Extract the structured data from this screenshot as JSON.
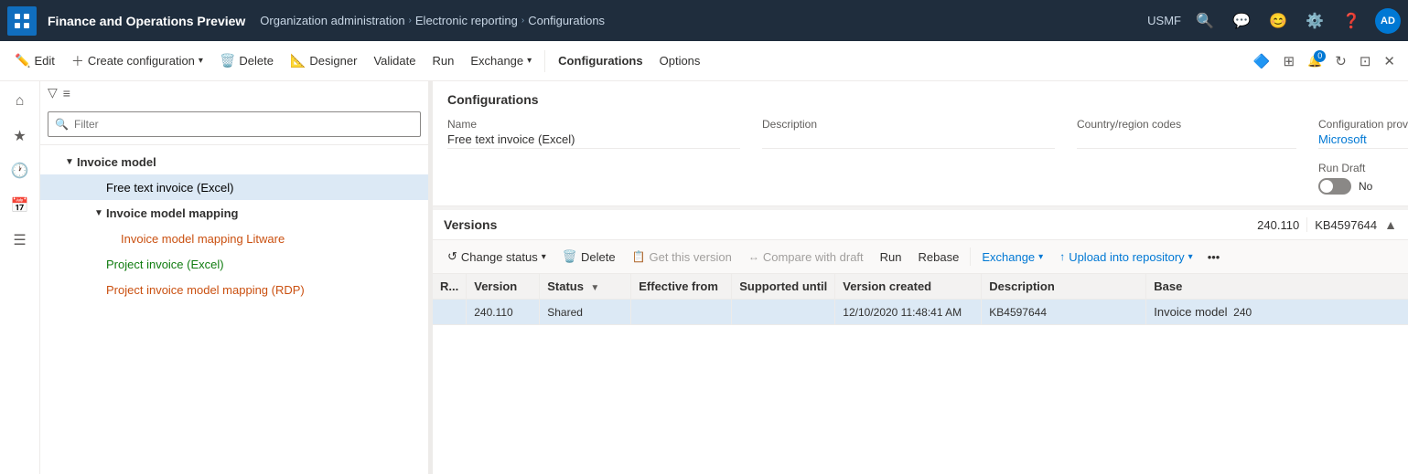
{
  "topNav": {
    "appIcon": "grid-icon",
    "title": "Finance and Operations Preview",
    "breadcrumbs": [
      {
        "label": "Organization administration"
      },
      {
        "label": "Electronic reporting"
      },
      {
        "label": "Configurations"
      }
    ],
    "orgLabel": "USMF",
    "icons": [
      "search-icon",
      "chat-icon",
      "smiley-icon",
      "settings-icon",
      "help-icon"
    ],
    "avatar": "AD"
  },
  "commandBar": {
    "editLabel": "Edit",
    "createConfigLabel": "Create configuration",
    "deleteLabel": "Delete",
    "designerLabel": "Designer",
    "validateLabel": "Validate",
    "runLabel": "Run",
    "exchangeLabel": "Exchange",
    "configurationsLabel": "Configurations",
    "optionsLabel": "Options"
  },
  "treePanel": {
    "filterPlaceholder": "Filter",
    "items": [
      {
        "id": "invoice-model",
        "label": "Invoice model",
        "indent": 1,
        "type": "bold",
        "expanded": true,
        "hasExpand": true
      },
      {
        "id": "free-text-excel",
        "label": "Free text invoice (Excel)",
        "indent": 2,
        "type": "normal",
        "selected": true,
        "hasExpand": false
      },
      {
        "id": "invoice-model-mapping",
        "label": "Invoice model mapping",
        "indent": 2,
        "type": "bold",
        "expanded": true,
        "hasExpand": true
      },
      {
        "id": "invoice-model-mapping-litware",
        "label": "Invoice model mapping Litware",
        "indent": 3,
        "type": "orange",
        "hasExpand": false
      },
      {
        "id": "project-invoice-excel",
        "label": "Project invoice (Excel)",
        "indent": 2,
        "type": "green",
        "hasExpand": false
      },
      {
        "id": "project-invoice-model-mapping-rdp",
        "label": "Project invoice model mapping (RDP)",
        "indent": 2,
        "type": "orange",
        "hasExpand": false
      }
    ]
  },
  "detailPanel": {
    "sectionTitle": "Configurations",
    "fields": {
      "nameLabel": "Name",
      "nameValue": "Free text invoice (Excel)",
      "descriptionLabel": "Description",
      "descriptionValue": "",
      "countryLabel": "Country/region codes",
      "countryValue": "",
      "configProviderLabel": "Configuration provider",
      "configProviderValue": "Microsoft"
    },
    "runDraft": {
      "label": "Run Draft",
      "toggleState": false,
      "toggleText": "No"
    }
  },
  "versionsSection": {
    "title": "Versions",
    "metaVersion": "240.110",
    "metaKB": "KB4597644",
    "toolbar": {
      "changeStatusLabel": "Change status",
      "deleteLabel": "Delete",
      "getThisVersionLabel": "Get this version",
      "compareWithDraftLabel": "Compare with draft",
      "runLabel": "Run",
      "rebaseLabel": "Rebase",
      "exchangeLabel": "Exchange",
      "uploadIntoRepositoryLabel": "Upload into repository"
    },
    "tableHeaders": [
      "R...",
      "Version",
      "Status",
      "Effective from",
      "Supported until",
      "Version created",
      "Description",
      "Base"
    ],
    "rows": [
      {
        "r": "",
        "version": "240.110",
        "status": "Shared",
        "effectiveFrom": "",
        "supportedUntil": "",
        "versionCreated": "12/10/2020 11:48:41 AM",
        "description": "KB4597644",
        "base": "Invoice model",
        "baseNum": "240",
        "selected": true
      }
    ]
  }
}
